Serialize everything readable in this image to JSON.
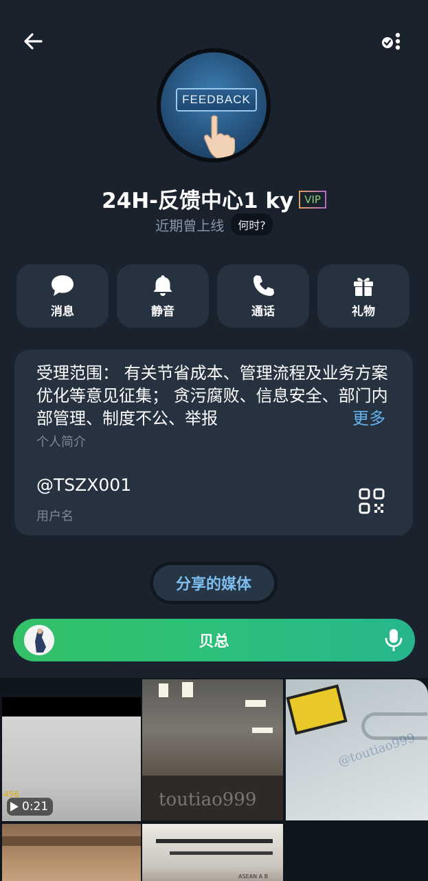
{
  "topbar": {
    "back_icon": "arrow-left-icon",
    "more_icon": "settings-dots-icon"
  },
  "avatar": {
    "label": "FEEDBACK"
  },
  "profile": {
    "name": "24H-反馈中心1 ky",
    "badge": "VIP",
    "status": "近期曾上线",
    "status_chip": "何时?"
  },
  "actions": [
    {
      "label": "消息",
      "icon": "chat-bubble-icon"
    },
    {
      "label": "静音",
      "icon": "bell-icon"
    },
    {
      "label": "通话",
      "icon": "phone-icon"
    },
    {
      "label": "礼物",
      "icon": "gift-icon"
    }
  ],
  "info": {
    "bio": "受理范围： 有关节省成本、管理流程及业务方案优化等意见征集； 贪污腐败、信息安全、部门内部管理、制度不公、举报",
    "more_label": "更多",
    "bio_caption": "个人简介",
    "username": "@TSZX001",
    "username_caption": "用户名",
    "qr_icon": "qr-code-icon"
  },
  "media_button": {
    "label": "分享的媒体"
  },
  "music_bar": {
    "title": "贝总",
    "mic_icon": "microphone-icon"
  },
  "media_grid": {
    "tiles": [
      {
        "duration": "0:21",
        "overlay_text": "456"
      },
      {
        "watermark": "toutiao999"
      },
      {
        "watermark": "@toutiao999"
      },
      {},
      {
        "sign_text": "ASEAN A B"
      }
    ]
  },
  "colors": {
    "background": "#1a222d",
    "card": "#263240",
    "accent_link": "#64b3f0",
    "music_green": "#33c067"
  }
}
